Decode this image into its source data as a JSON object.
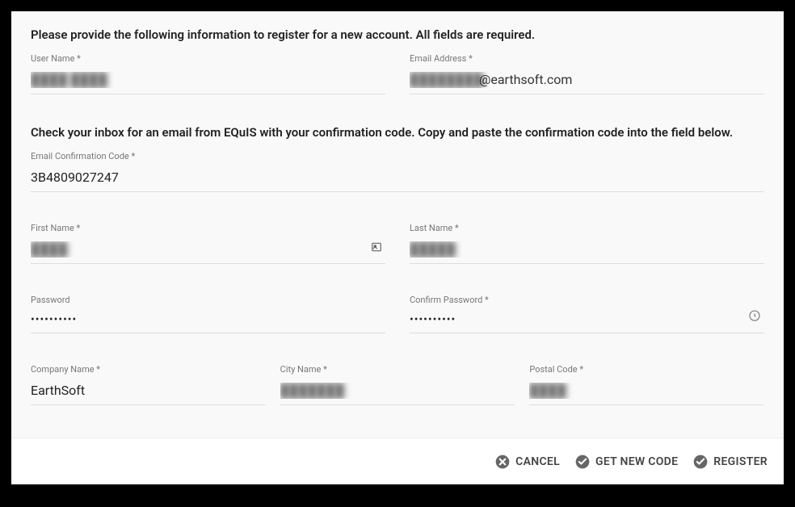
{
  "headings": {
    "main": "Please provide the following information to register for a new account. All fields are required.",
    "confirmation": "Check your inbox for an email from EQuIS with your confirmation code. Copy and paste the confirmation code into the field below."
  },
  "fields": {
    "username": {
      "label": "User Name *",
      "value": "████ ████"
    },
    "email": {
      "label": "Email Address *",
      "value": "████████",
      "suffix": "@earthsoft.com"
    },
    "confirmation_code": {
      "label": "Email Confirmation Code *",
      "value": "3B4809027247"
    },
    "first_name": {
      "label": "First Name *",
      "value": "████"
    },
    "last_name": {
      "label": "Last Name *",
      "value": "█████"
    },
    "password": {
      "label": "Password",
      "value": "••••••••••"
    },
    "confirm_password": {
      "label": "Confirm Password *",
      "value": "••••••••••"
    },
    "company": {
      "label": "Company Name *",
      "value": "EarthSoft"
    },
    "city": {
      "label": "City Name *",
      "value": "███████"
    },
    "postal": {
      "label": "Postal Code *",
      "value": "████"
    }
  },
  "actions": {
    "cancel": "CANCEL",
    "getcode": "GET NEW CODE",
    "register": "REGISTER"
  }
}
